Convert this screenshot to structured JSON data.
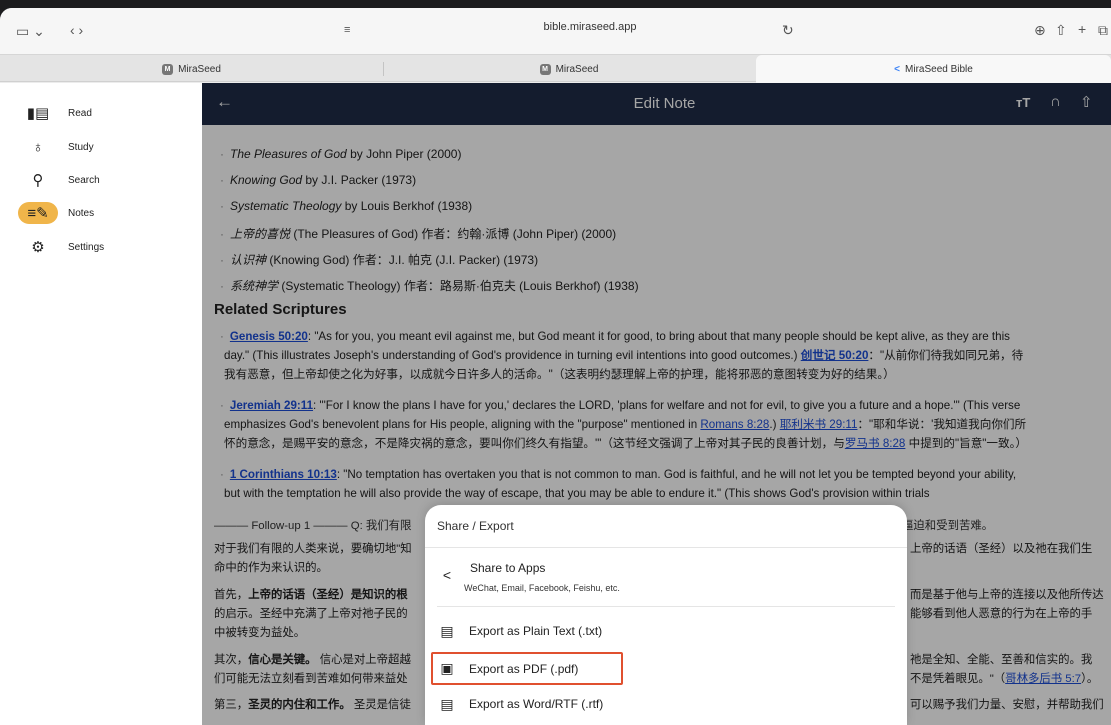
{
  "browser": {
    "url": "bible.miraseed.app",
    "tabs": [
      {
        "label": "MiraSeed",
        "icon": "M"
      },
      {
        "label": "MiraSeed",
        "icon": "M"
      },
      {
        "label": "MiraSeed Bible",
        "icon": "<"
      }
    ]
  },
  "sidebar": {
    "items": [
      {
        "label": "Read",
        "icon": "book-icon"
      },
      {
        "label": "Study",
        "icon": "lightbulb-icon"
      },
      {
        "label": "Search",
        "icon": "search-icon"
      },
      {
        "label": "Notes",
        "icon": "edit-note-icon",
        "active": true
      },
      {
        "label": "Settings",
        "icon": "gear-icon"
      }
    ]
  },
  "appbar": {
    "title": "Edit Note"
  },
  "content": {
    "books": [
      {
        "title": "The Pleasures of God",
        "rest": " by John Piper (2000)"
      },
      {
        "title": "Knowing God",
        "rest": " by J.I. Packer (1973)"
      },
      {
        "title": "Systematic Theology",
        "rest": " by Louis Berkhof (1938)"
      },
      {
        "title": "上帝的喜悦",
        "rest": " (The Pleasures of God) 作者：约翰·派博 (John Piper) (2000)"
      },
      {
        "title": "认识神",
        "rest": " (Knowing God) 作者：J.I. 帕克 (J.I. Packer) (1973)"
      },
      {
        "title": "系统神学",
        "rest": " (Systematic Theology) 作者：路易斯·伯克夫 (Louis Berkhof) (1938)"
      }
    ],
    "related_heading": "Related Scriptures",
    "scriptures": [
      {
        "ref": "Genesis 50:20",
        "l1": ": \"As for you, you meant evil against me, but God meant it for good, to bring about that many people should be kept alive, as they are this",
        "l2a": "day.\" (This illustrates Joseph's understanding of God's providence in turning evil intentions into good outcomes.) ",
        "l2ref": "创世记 50:20",
        "l2b": "：\"从前你们待我如同兄弟，待",
        "l3": "我有恶意，但上帝却使之化为好事，以成就今日许多人的活命。\"（这表明约瑟理解上帝的护理，能将邪恶的意图转变为好的结果。）"
      },
      {
        "ref": "Jeremiah 29:11",
        "l1": ": \"'For I know the plans I have for you,' declares the LORD, 'plans for welfare and not for evil, to give you a future and a hope.'\" (This verse",
        "l2a": "emphasizes God's benevolent plans for His people, aligning with the \"purpose\" mentioned in ",
        "l2ref": "Romans 8:28",
        "l2mid": ".) ",
        "l2ref2": "耶利米书 29:11",
        "l2b": "：\"耶和华说：'我知道我向你们所",
        "l3a": "怀的意念，是赐平安的意念，不是降灾祸的意念，要叫你们终久有指望。'\"（这节经文强调了上帝对其子民的良善计划，与",
        "l3ref": "罗马书 8:28",
        "l3b": " 中提到的\"旨意\"一致。）"
      },
      {
        "ref": "1 Corinthians 10:13",
        "l1": ": \"No temptation has overtaken you that is not common to man. God is faithful, and he will not let you be tempted beyond your ability,",
        "l2": "but with the temptation he will also provide the way of escape, that you may be able to endure it.\" (This shows God's provision within trials"
      }
    ],
    "followup_left": "——— Follow-up 1 ——— Q: 我们有限",
    "followup_right": "逼迫和受到苦难。",
    "lines": [
      {
        "left": "对于我们有限的人类来说，要确切地\"知",
        "right": "上帝的话语（圣经）以及祂在我们生"
      },
      {
        "left": "命中的作为来认识的。",
        "right": ""
      },
      {
        "left_bold": "上帝的话语（圣经）是知识的根",
        "left_pre": "首先，",
        "right": "而是基于他与上帝的连接以及他所传达"
      },
      {
        "left": "的启示。圣经中充满了上帝对祂子民的",
        "right": "能够看到他人恶意的行为在上帝的手"
      },
      {
        "left": "中被转变为益处。",
        "right": ""
      },
      {
        "left_pre": "其次，",
        "left_bold": "信心是关键。",
        "left_post": " 信心是对上帝超越",
        "right": "祂是全知、全能、至善和信实的。我"
      },
      {
        "left": "们可能无法立刻看到苦难如何带来益处",
        "right_pre": "不是凭着眼见。\"（",
        "right_ref": "哥林多后书 5:7",
        "right_post": "）。"
      },
      {
        "left_pre": "第三，",
        "left_bold": "圣灵的内住和工作。",
        "left_post": " 圣灵是信徒",
        "right": "可以赐予我们力量、安慰，并帮助我们"
      }
    ]
  },
  "sheet": {
    "title": "Share / Export",
    "share_label": "Share to Apps",
    "share_sub": "WeChat, Email, Facebook, Feishu, etc.",
    "txt_label": "Export as Plain Text (.txt)",
    "pdf_label": "Export as PDF (.pdf)",
    "rtf_label": "Export as Word/RTF (.rtf)"
  }
}
